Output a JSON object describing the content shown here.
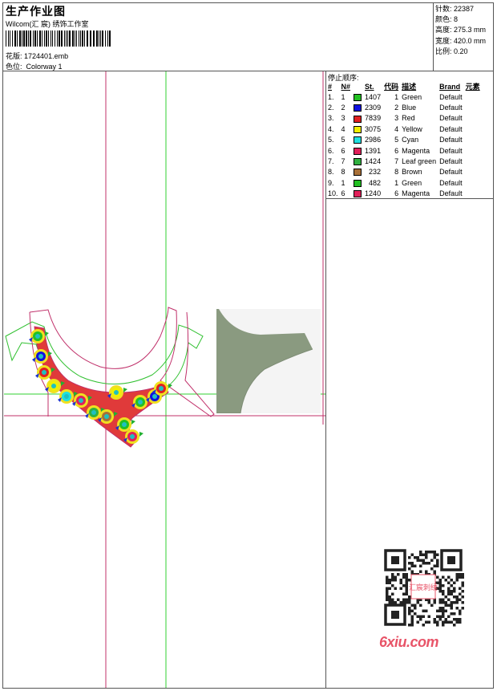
{
  "header": {
    "title": "生产作业图",
    "subtitle": "Wilcom(汇 宸) 绣饰工作室",
    "design_label": "花版:",
    "design_file": "1724401.emb",
    "colorway_label": "色位:",
    "colorway": "Colorway 1"
  },
  "stats": [
    {
      "label": "针数:",
      "value": "22387"
    },
    {
      "label": "颜色:",
      "value": "8"
    },
    {
      "label": "高度:",
      "value": "275.3 mm"
    },
    {
      "label": "宽度:",
      "value": "420.0 mm"
    },
    {
      "label": "比例:",
      "value": "0.20"
    }
  ],
  "stop_sequence": {
    "title": "停止顺序:",
    "columns": [
      "#",
      "N#",
      "St.",
      "代码",
      "描述",
      "Brand",
      "元素"
    ],
    "rows": [
      {
        "idx": "1.",
        "n": "1",
        "color": "#22c022",
        "st": "1407",
        "code": "1",
        "desc": "Green",
        "brand": "Default"
      },
      {
        "idx": "2.",
        "n": "2",
        "color": "#1010e0",
        "st": "2309",
        "code": "2",
        "desc": "Blue",
        "brand": "Default"
      },
      {
        "idx": "3.",
        "n": "3",
        "color": "#e02020",
        "st": "7839",
        "code": "3",
        "desc": "Red",
        "brand": "Default"
      },
      {
        "idx": "4.",
        "n": "4",
        "color": "#f0f000",
        "st": "3075",
        "code": "4",
        "desc": "Yellow",
        "brand": "Default"
      },
      {
        "idx": "5.",
        "n": "5",
        "color": "#20e0e0",
        "st": "2986",
        "code": "5",
        "desc": "Cyan",
        "brand": "Default"
      },
      {
        "idx": "6.",
        "n": "6",
        "color": "#e0205a",
        "st": "1391",
        "code": "6",
        "desc": "Magenta",
        "brand": "Default"
      },
      {
        "idx": "7.",
        "n": "7",
        "color": "#30b040",
        "st": "1424",
        "code": "7",
        "desc": "Leaf green",
        "brand": "Default"
      },
      {
        "idx": "8.",
        "n": "8",
        "color": "#a87038",
        "st": "232",
        "code": "8",
        "desc": "Brown",
        "brand": "Default"
      },
      {
        "idx": "9.",
        "n": "1",
        "color": "#22c022",
        "st": "482",
        "code": "1",
        "desc": "Green",
        "brand": "Default"
      },
      {
        "idx": "10.",
        "n": "6",
        "color": "#e0205a",
        "st": "1240",
        "code": "6",
        "desc": "Magenta",
        "brand": "Default"
      }
    ]
  },
  "watermark": {
    "site": "6xiu.com",
    "seal": "汇宸刺绣"
  }
}
